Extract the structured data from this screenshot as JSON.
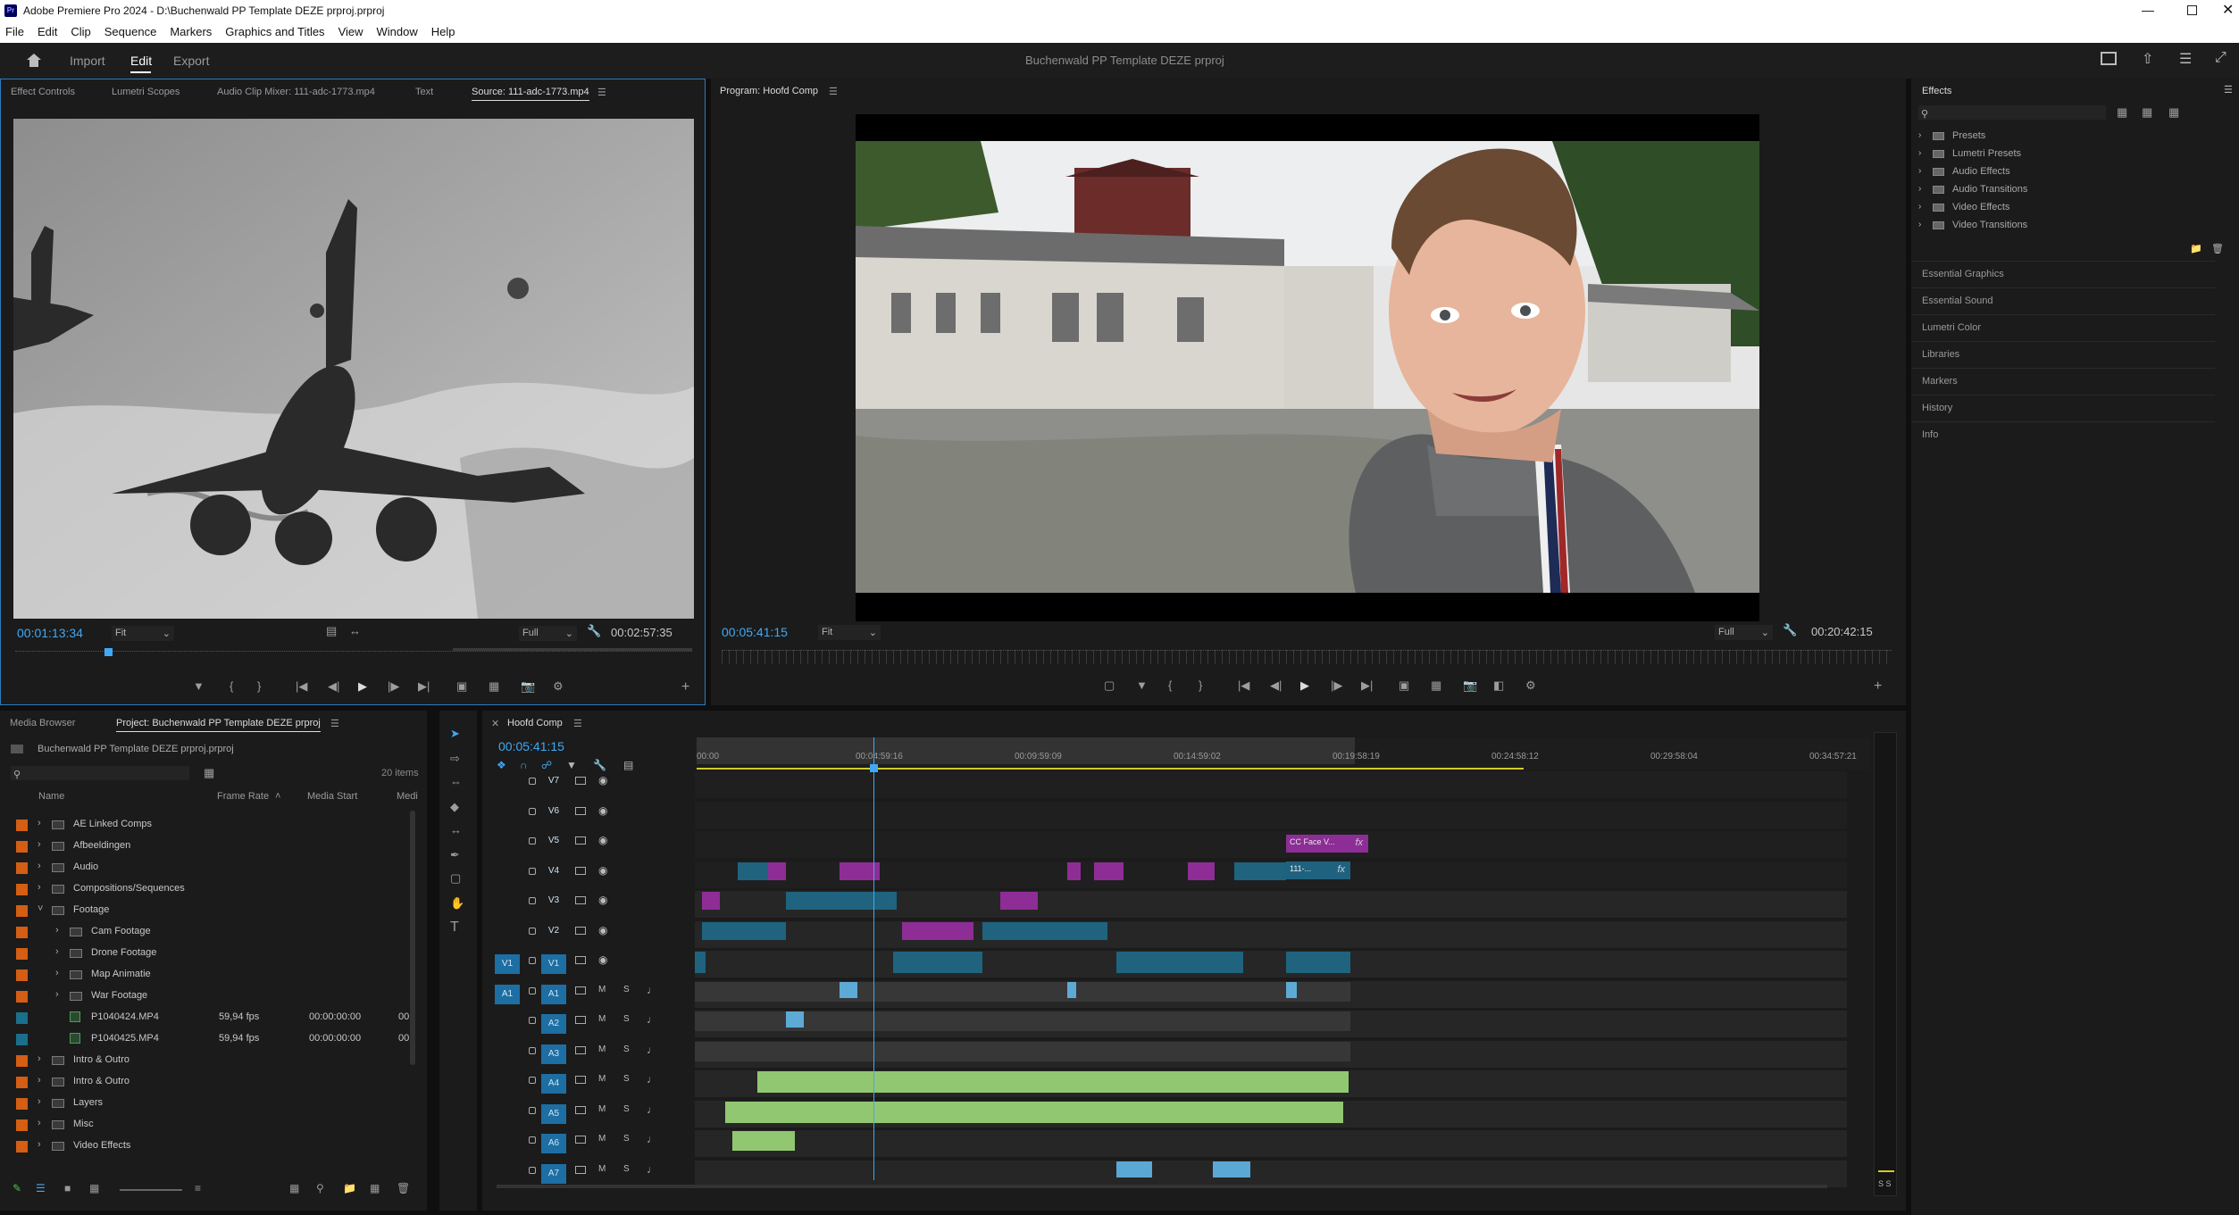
{
  "app": {
    "logo": "Pr",
    "title": "Adobe Premiere Pro 2024 - D:\\Buchenwald PP Template DEZE prproj.prproj"
  },
  "menu": [
    "File",
    "Edit",
    "Clip",
    "Sequence",
    "Markers",
    "Graphics and Titles",
    "View",
    "Window",
    "Help"
  ],
  "workspace": {
    "tabs": [
      "Import",
      "Edit",
      "Export"
    ],
    "active": "Edit",
    "project_title": "Buchenwald PP Template DEZE prproj"
  },
  "source_panel": {
    "tabs": [
      "Effect Controls",
      "Lumetri Scopes",
      "Audio Clip Mixer: 111-adc-1773.mp4",
      "Text",
      "Source: 111-adc-1773.mp4"
    ],
    "timecode": "00:01:13:34",
    "zoom": "Fit",
    "quality": "Full",
    "duration": "00:02:57:35",
    "playhead_fraction": 0.137
  },
  "program_panel": {
    "tab": "Program: Hoofd Comp",
    "timecode": "00:05:41:15",
    "zoom": "Fit",
    "quality": "Full",
    "duration": "00:20:42:15"
  },
  "effects_panel": {
    "tab": "Effects",
    "folders": [
      "Presets",
      "Lumetri Presets",
      "Audio Effects",
      "Audio Transitions",
      "Video Effects",
      "Video Transitions"
    ],
    "side_panels": [
      "Essential Graphics",
      "Essential Sound",
      "Lumetri Color",
      "Libraries",
      "Markers",
      "History",
      "Info"
    ]
  },
  "project_panel": {
    "tabs": [
      "Media Browser",
      "Project: Buchenwald PP Template DEZE prproj"
    ],
    "file": "Buchenwald PP Template DEZE prproj.prproj",
    "items_count": "20 items",
    "columns": [
      "Name",
      "Frame Rate",
      "Media Start",
      "Medi"
    ],
    "rows": [
      {
        "name": "AE Linked Comps",
        "indent": 0,
        "type": "folder",
        "open": false,
        "color": "#d35e14"
      },
      {
        "name": "Afbeeldingen",
        "indent": 0,
        "type": "folder",
        "open": false,
        "color": "#d35e14"
      },
      {
        "name": "Audio",
        "indent": 0,
        "type": "folder",
        "open": false,
        "color": "#d35e14"
      },
      {
        "name": "Compositions/Sequences",
        "indent": 0,
        "type": "folder",
        "open": false,
        "color": "#d35e14"
      },
      {
        "name": "Footage",
        "indent": 0,
        "type": "folder",
        "open": true,
        "color": "#d35e14"
      },
      {
        "name": "Cam Footage",
        "indent": 1,
        "type": "folder",
        "open": false,
        "color": "#d35e14"
      },
      {
        "name": "Drone Footage",
        "indent": 1,
        "type": "folder",
        "open": false,
        "color": "#d35e14"
      },
      {
        "name": "Map Animatie",
        "indent": 1,
        "type": "folder",
        "open": false,
        "color": "#d35e14"
      },
      {
        "name": "War Footage",
        "indent": 1,
        "type": "folder",
        "open": false,
        "color": "#d35e14"
      },
      {
        "name": "P1040424.MP4",
        "indent": 1,
        "type": "clip",
        "fps": "59,94 fps",
        "start": "00:00:00:00",
        "extra": "00",
        "color": "#1a6f8c"
      },
      {
        "name": "P1040425.MP4",
        "indent": 1,
        "type": "clip",
        "fps": "59,94 fps",
        "start": "00:00:00:00",
        "extra": "00",
        "color": "#1a6f8c"
      },
      {
        "name": "Intro & Outro",
        "indent": 0,
        "type": "folder",
        "open": false,
        "color": "#d35e14"
      },
      {
        "name": "Intro & Outro",
        "indent": 0,
        "type": "folder",
        "open": false,
        "color": "#d35e14"
      },
      {
        "name": "Layers",
        "indent": 0,
        "type": "folder",
        "open": false,
        "color": "#d35e14"
      },
      {
        "name": "Misc",
        "indent": 0,
        "type": "folder",
        "open": false,
        "color": "#d35e14"
      },
      {
        "name": "Video Effects",
        "indent": 0,
        "type": "folder",
        "open": false,
        "color": "#d35e14"
      }
    ]
  },
  "timeline": {
    "tab": "Hoofd Comp",
    "timecode": "00:05:41:15",
    "ruler": [
      "00:00",
      "00:04:59:16",
      "00:09:59:09",
      "00:14:59:02",
      "00:19:58:19",
      "00:24:58:12",
      "00:29:58:04",
      "00:34:57:21"
    ],
    "video_tracks": [
      "V7",
      "V6",
      "V5",
      "V4",
      "V3",
      "V2",
      "V1"
    ],
    "audio_tracks": [
      "A1",
      "A2",
      "A3",
      "A4",
      "A5",
      "A6",
      "A7"
    ],
    "source_patch_video": "V1",
    "source_patch_audio": "A1",
    "clip_labels": {
      "v5": "CC Face V...",
      "v4": "111-..."
    },
    "track_buttons": {
      "mute": "M",
      "solo": "S"
    },
    "meter_label": "S S"
  },
  "colors": {
    "accent": "#3fa9f5",
    "video_clip": "#1f6a8a",
    "purple_clip": "#9a2fa3",
    "audio_green": "#9fd97a",
    "folder_swatch": "#d35e14"
  }
}
